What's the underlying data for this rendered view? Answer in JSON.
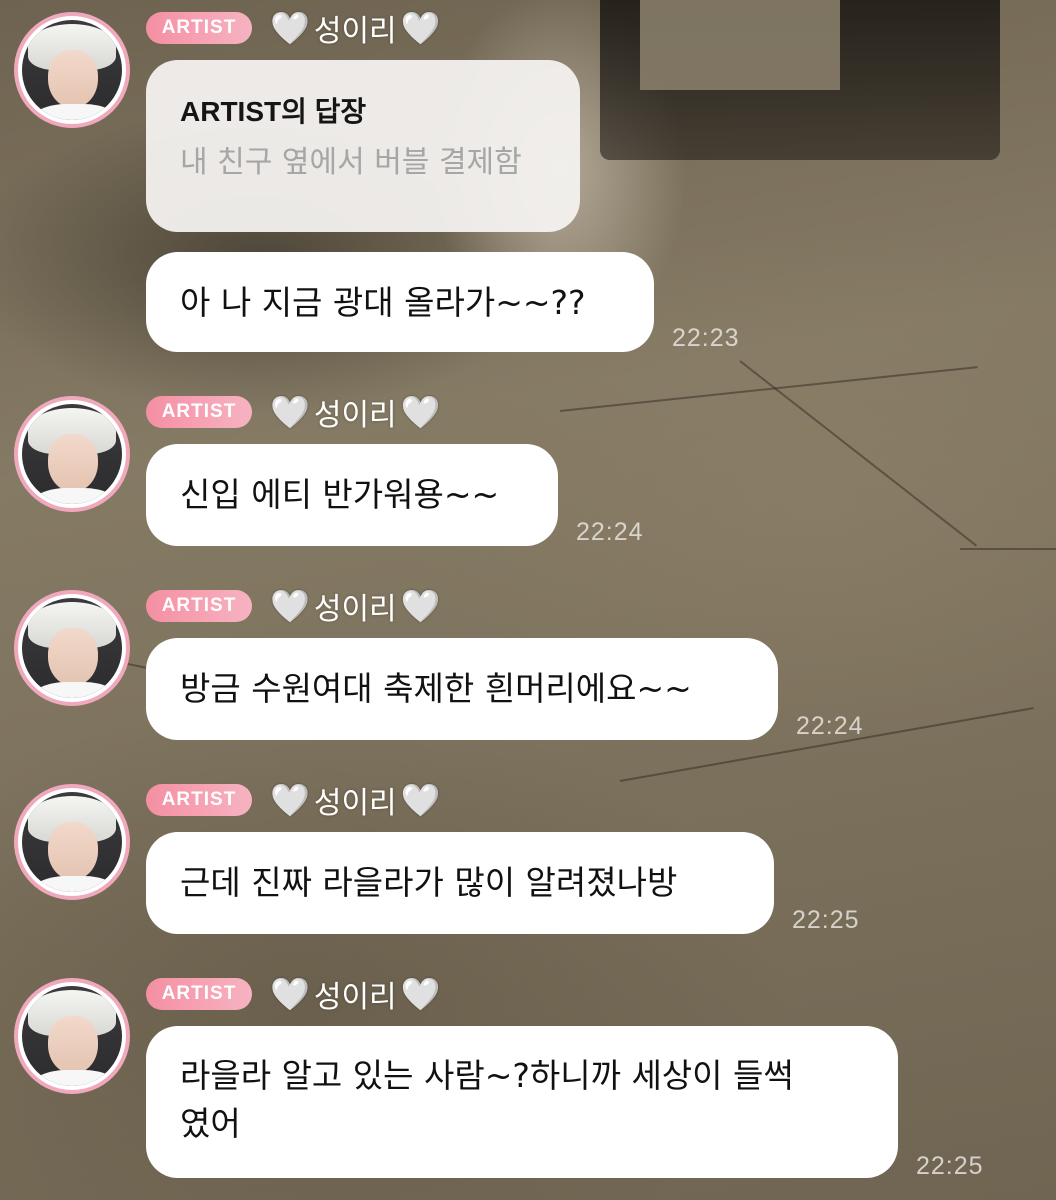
{
  "messages": [
    {
      "badge": "ARTIST",
      "sender": "성이리",
      "reply": {
        "title": "ARTIST의 답장",
        "quoted": "내 친구 옆에서 버블 결제함"
      },
      "text": "아 나 지금 광대 올라가~~??",
      "time": "22:23"
    },
    {
      "badge": "ARTIST",
      "sender": "성이리",
      "text": "신입 에티 반가워용~~",
      "time": "22:24"
    },
    {
      "badge": "ARTIST",
      "sender": "성이리",
      "text": "방금 수원여대 축제한 흰머리에요~~",
      "time": "22:24"
    },
    {
      "badge": "ARTIST",
      "sender": "성이리",
      "text": "근데 진짜 라을라가 많이 알려졌나방",
      "time": "22:25"
    },
    {
      "badge": "ARTIST",
      "sender": "성이리",
      "text_line1": "라을라 알고 있는 사람~?하니까 세상이 들썩",
      "text_line2": "였어",
      "time": "22:25"
    }
  ],
  "icons": {
    "sender_decoration": "white-heart-icon",
    "avatar": "profile-photo"
  },
  "colors": {
    "badge": "#f58fa3",
    "avatar_ring": "#f0a9bc",
    "bubble": "#ffffff",
    "reply_quote_text": "#a6a6a6"
  }
}
